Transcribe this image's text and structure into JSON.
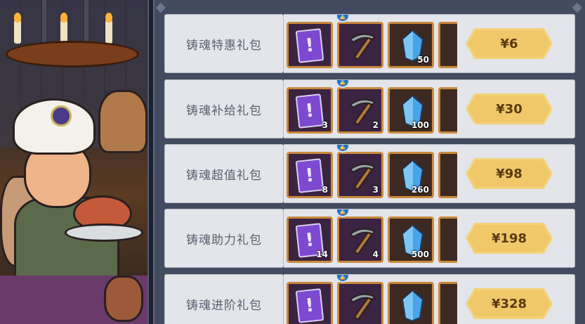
{
  "packs": [
    {
      "name": "铸魂特惠礼包",
      "price": "¥6",
      "items": [
        {
          "icon": "purple-card-icon",
          "qty": ""
        },
        {
          "icon": "pickaxe-icon",
          "qty": ""
        },
        {
          "icon": "blue-crystal-icon",
          "qty": "50"
        }
      ]
    },
    {
      "name": "铸魂补给礼包",
      "price": "¥30",
      "items": [
        {
          "icon": "purple-card-icon",
          "qty": "3"
        },
        {
          "icon": "pickaxe-icon",
          "qty": "2"
        },
        {
          "icon": "blue-crystal-icon",
          "qty": "100"
        }
      ]
    },
    {
      "name": "铸魂超值礼包",
      "price": "¥98",
      "items": [
        {
          "icon": "purple-card-icon",
          "qty": "8"
        },
        {
          "icon": "pickaxe-icon",
          "qty": "3"
        },
        {
          "icon": "blue-crystal-icon",
          "qty": "260"
        }
      ]
    },
    {
      "name": "铸魂助力礼包",
      "price": "¥198",
      "items": [
        {
          "icon": "purple-card-icon",
          "qty": "14"
        },
        {
          "icon": "pickaxe-icon",
          "qty": "4"
        },
        {
          "icon": "blue-crystal-icon",
          "qty": "500"
        }
      ]
    },
    {
      "name": "铸魂进阶礼包",
      "price": "¥328",
      "items": [
        {
          "icon": "purple-card-icon",
          "qty": ""
        },
        {
          "icon": "pickaxe-icon",
          "qty": ""
        },
        {
          "icon": "blue-crystal-icon",
          "qty": ""
        }
      ]
    }
  ],
  "colors": {
    "panel_bg": "#434b60",
    "row_bg": "#e3e5ea",
    "slot_border": "#c98a3c",
    "price_button": "#f0c86a",
    "price_text": "#5a3a10",
    "label_text": "#5c6070",
    "limited_badge": "#2a6fb8"
  },
  "badge_icon": "hourglass-icon"
}
